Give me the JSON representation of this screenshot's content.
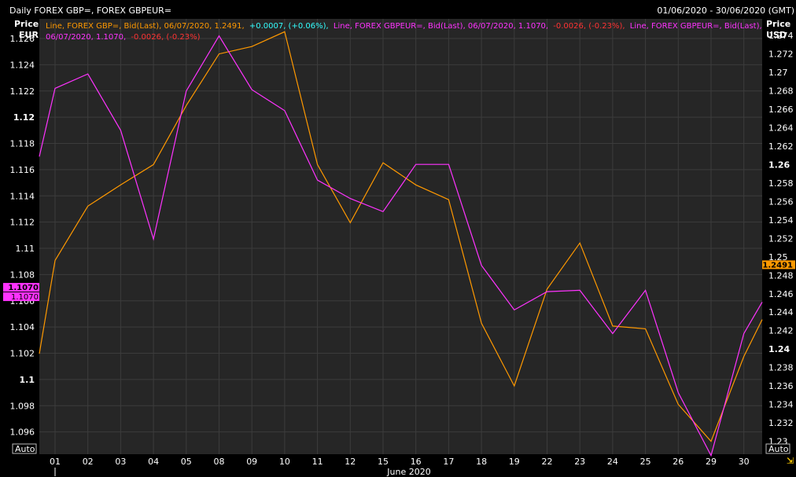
{
  "header": {
    "title": "Daily FOREX GBP=, FOREX GBPEUR=",
    "date_range": "01/06/2020 - 30/06/2020 (GMT)"
  },
  "colors": {
    "series_gbp": "#ff9900",
    "series_gbpeur": "#ff33ff",
    "change_positive": "#33ffff",
    "change_negative": "#ff3333",
    "background": "#262626",
    "grid": "#3c3c3c"
  },
  "legend": {
    "gbp_desc": "Line, FOREX GBP=, Bid(Last), 06/07/2020, 1.2491,",
    "gbp_change": "+0.0007, (+0.06%),",
    "gbpeur_desc_1": "Line, FOREX GBPEUR=, Bid(Last), 06/07/2020, 1.1070,",
    "gbpeur_change_1": "-0.0026, (-0.23%),",
    "tail_desc": "Line, FOREX GBPEUR=, Bid(Last),",
    "gbpeur_desc_2": "06/07/2020, 1.1070,",
    "gbpeur_change_2": "-0.0026, (-0.23%)"
  },
  "left_axis": {
    "title_1": "Price",
    "title_2": "EUR",
    "auto_label": "Auto",
    "last_badge": "1.1070",
    "last_badge_2": "1.1070"
  },
  "right_axis": {
    "title_1": "Price",
    "title_2": "USD",
    "auto_label": "Auto",
    "last_badge": "1.2491"
  },
  "x_axis_label": "June 2020",
  "chart_data": {
    "type": "line",
    "title": "Daily FOREX GBP=, FOREX GBPEUR=",
    "xlabel": "June 2020",
    "categories": [
      "01",
      "02",
      "03",
      "04",
      "05",
      "08",
      "09",
      "10",
      "11",
      "12",
      "15",
      "16",
      "17",
      "18",
      "19",
      "22",
      "23",
      "24",
      "25",
      "26",
      "29",
      "30"
    ],
    "y_left": {
      "label": "Price EUR",
      "range": [
        1.0943,
        1.1275
      ],
      "ticks": [
        "1.096",
        "1.098",
        "1.1",
        "1.102",
        "1.104",
        "1.106",
        "1.108",
        "1.11",
        "1.112",
        "1.114",
        "1.116",
        "1.118",
        "1.12",
        "1.122",
        "1.124",
        "1.126"
      ],
      "bold_ticks": [
        "1.1",
        "1.12"
      ]
    },
    "y_right": {
      "label": "Price USD",
      "range": [
        1.2286,
        1.2758
      ],
      "ticks": [
        "1.23",
        "1.232",
        "1.234",
        "1.236",
        "1.238",
        "1.24",
        "1.242",
        "1.244",
        "1.246",
        "1.248",
        "1.25",
        "1.252",
        "1.254",
        "1.256",
        "1.258",
        "1.26",
        "1.262",
        "1.264",
        "1.266",
        "1.268",
        "1.27",
        "1.272",
        "1.274"
      ],
      "bold_ticks": [
        "1.24",
        "1.26"
      ]
    },
    "series": [
      {
        "name": "FOREX GBP=",
        "axis": "right",
        "color": "#ff9900",
        "start": 1.2395,
        "values": [
          1.2496,
          1.2555,
          1.2578,
          1.26,
          1.2664,
          1.272,
          1.2728,
          1.2744,
          1.26,
          1.2537,
          1.2602,
          1.2578,
          1.2562,
          1.2428,
          1.236,
          1.2465,
          1.2515,
          1.2425,
          1.2422,
          1.234,
          1.23,
          1.2392
        ],
        "end": 1.2432
      },
      {
        "name": "FOREX GBPEUR=",
        "axis": "left",
        "color": "#ff33ff",
        "start": 1.117,
        "values": [
          1.1222,
          1.1233,
          1.119,
          1.1107,
          1.122,
          1.1262,
          1.1221,
          1.1205,
          1.1152,
          1.1138,
          1.1128,
          1.1164,
          1.1164,
          1.1087,
          1.1053,
          1.1067,
          1.1068,
          1.1035,
          1.1068,
          1.099,
          1.0942,
          1.1035
        ],
        "end": 1.1059
      }
    ],
    "last_values": {
      "FOREX GBP=": 1.2491,
      "FOREX GBPEUR=": 1.107
    },
    "grid": true,
    "legend_position": "top-left"
  }
}
